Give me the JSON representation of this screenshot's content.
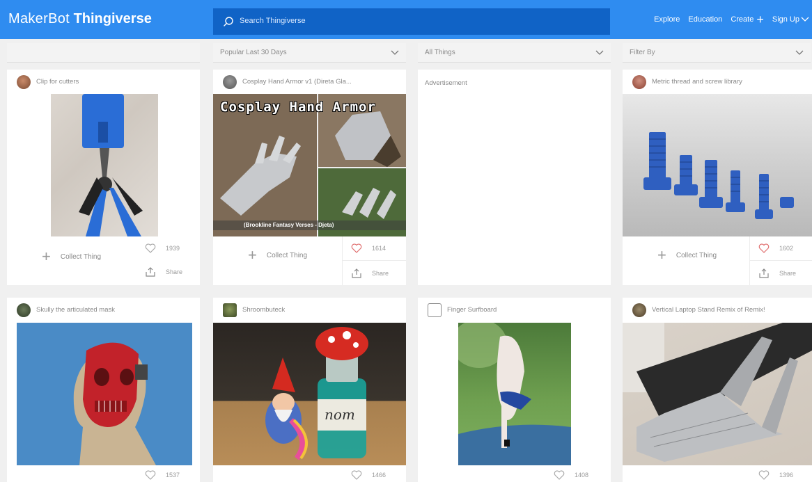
{
  "header": {
    "logo_part1": "MakerBot",
    "logo_part2": "Thingiverse",
    "search_placeholder": "Search Thingiverse",
    "nav": [
      "Explore",
      "Education",
      "Create",
      "Sign Up"
    ]
  },
  "filters": [
    {
      "label": ""
    },
    {
      "label": "Popular Last 30 Days"
    },
    {
      "label": "All Things"
    },
    {
      "label": "Filter By"
    }
  ],
  "cards": [
    {
      "title": "Clip for cutters",
      "likes": "1939",
      "collect": "Collect Thing",
      "share": "Share"
    },
    {
      "title": "Cosplay Hand Armor v1 (Direta Gla...",
      "likes": "1614",
      "collect": "Collect Thing",
      "share": "Share",
      "image_text": "Cosplay Hand Armor",
      "image_caption": "(Brookline Fantasy Verses - Djeta)"
    },
    {
      "title": "Advertisement"
    },
    {
      "title": "Metric thread and screw library",
      "likes": "1602",
      "collect": "Collect Thing",
      "share": "Share"
    },
    {
      "title": "Skully the articulated mask",
      "likes": "1537"
    },
    {
      "title": "Shroombuteck",
      "likes": "1466",
      "image_text": "nom"
    },
    {
      "title": "Finger Surfboard",
      "likes": "1408"
    },
    {
      "title": "Vertical Laptop Stand Remix of Remix!",
      "likes": "1396"
    }
  ]
}
